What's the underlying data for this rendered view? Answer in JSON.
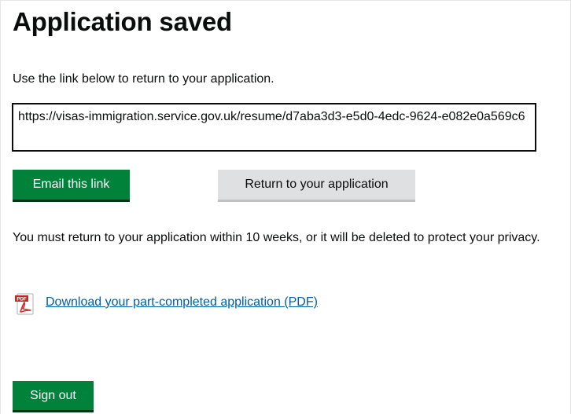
{
  "header": {
    "title": "Application saved"
  },
  "main": {
    "intro": "Use the link below to return to your application.",
    "resume_link": "https://visas-immigration.service.gov.uk/resume/d7aba3d3-e5d0-4edc-9624-e082e0a569c6",
    "email_button_label": "Email this link",
    "return_button_label": "Return to your application",
    "warning_text": "You must return to your application within 10 weeks, or it will be deleted to protect your privacy.",
    "pdf_icon_label": "PDF",
    "download_link_label": "Download your part-completed application (PDF)",
    "signout_button_label": "Sign out"
  },
  "colors": {
    "primary_button": "#00823b",
    "secondary_button": "#dee0e2",
    "link": "#005ea5",
    "text": "#0b0c0c",
    "pdf_icon": "#d32f2f"
  },
  "icons": {
    "pdf": "pdf-file-icon"
  }
}
